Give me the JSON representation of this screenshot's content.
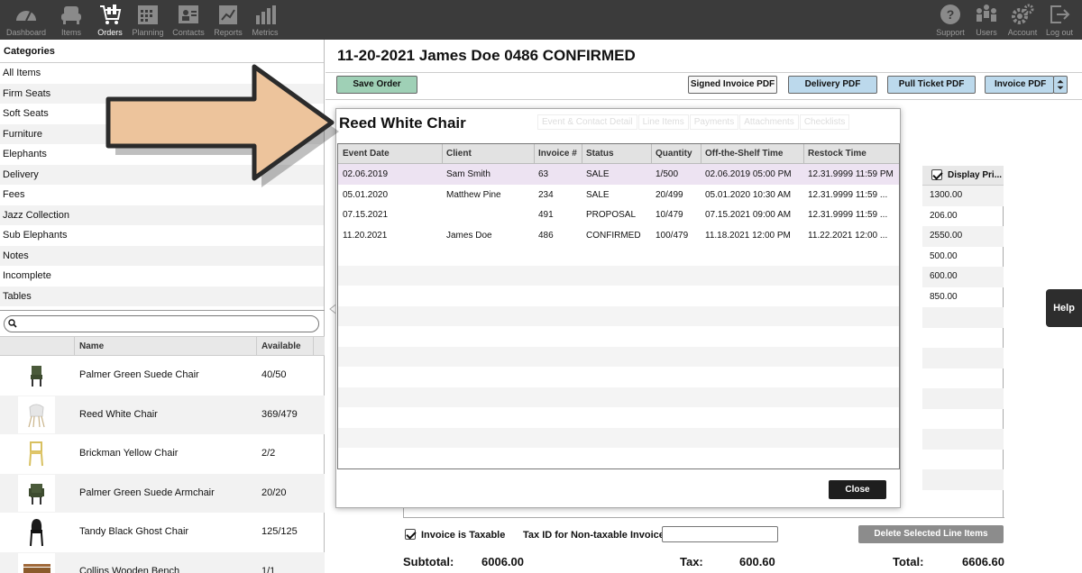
{
  "nav": {
    "left": [
      {
        "label": "Dashboard",
        "icon": "dashboard-icon"
      },
      {
        "label": "Items",
        "icon": "sofa-icon"
      },
      {
        "label": "Orders",
        "icon": "cart-icon",
        "active": true
      },
      {
        "label": "Planning",
        "icon": "calendar-icon"
      },
      {
        "label": "Contacts",
        "icon": "contacts-icon"
      },
      {
        "label": "Reports",
        "icon": "reports-icon"
      },
      {
        "label": "Metrics",
        "icon": "bar-chart-icon"
      }
    ],
    "right": [
      {
        "label": "Support",
        "icon": "help-icon"
      },
      {
        "label": "Users",
        "icon": "users-icon"
      },
      {
        "label": "Account",
        "icon": "gear-icon"
      },
      {
        "label": "Log out",
        "icon": "logout-icon"
      }
    ]
  },
  "categories": {
    "header": "Categories",
    "items": [
      "All Items",
      "Firm Seats",
      "Soft Seats",
      "Furniture",
      "Elephants",
      "Delivery",
      "Fees",
      "Jazz Collection",
      "Sub Elephants",
      "Notes",
      "Incomplete",
      "Tables"
    ]
  },
  "search": {
    "placeholder": ""
  },
  "items_table": {
    "headers": {
      "name": "Name",
      "available": "Available"
    },
    "rows": [
      {
        "name": "Palmer Green Suede Chair",
        "available": "40/50"
      },
      {
        "name": "Reed White Chair",
        "available": "369/479"
      },
      {
        "name": "Brickman Yellow Chair",
        "available": "2/2"
      },
      {
        "name": "Palmer Green Suede Armchair",
        "available": "20/20"
      },
      {
        "name": "Tandy Black Ghost Chair",
        "available": "125/125"
      },
      {
        "name": "Collins Wooden Bench",
        "available": "1/1"
      }
    ]
  },
  "order": {
    "title": "11-20-2021 James Doe 0486 CONFIRMED",
    "buttons": {
      "save": "Save Order",
      "signed_invoice": "Signed Invoice PDF",
      "delivery": "Delivery PDF",
      "pull_ticket": "Pull Ticket PDF",
      "invoice": "Invoice PDF"
    },
    "display_price_header": "Display Pri...",
    "display_prices": [
      "1300.00",
      "206.00",
      "2550.00",
      "500.00",
      "600.00",
      "850.00"
    ],
    "taxable_label": "Invoice is Taxable",
    "tax_id_label": "Tax ID for Non-taxable Invoice:",
    "tax_id_value": "",
    "delete_button": "Delete Selected Line Items",
    "subtotal_label": "Subtotal:",
    "subtotal_value": "6006.00",
    "tax_label": "Tax:",
    "tax_value": "600.60",
    "total_label": "Total:",
    "total_value": "6606.60",
    "help": "Help"
  },
  "modal": {
    "title": "Reed White Chair",
    "ghost_tabs": [
      "Event & Contact Detail",
      "Line Items",
      "Payments",
      "Attachments",
      "Checklists"
    ],
    "headers": [
      "Event Date",
      "Client",
      "Invoice #",
      "Status",
      "Quantity",
      "Off-the-Shelf Time",
      "Restock Time"
    ],
    "rows": [
      {
        "event_date": "02.06.2019",
        "client": "Sam Smith",
        "invoice": "63",
        "status": "SALE",
        "quantity": "1/500",
        "off_shelf": "02.06.2019 05:00 PM",
        "restock": "12.31.9999 11:59 PM"
      },
      {
        "event_date": "05.01.2020",
        "client": "Matthew Pine",
        "invoice": "234",
        "status": "SALE",
        "quantity": "20/499",
        "off_shelf": "05.01.2020 10:30 AM",
        "restock": "12.31.9999 11:59 ..."
      },
      {
        "event_date": "07.15.2021",
        "client": "",
        "invoice": "491",
        "status": "PROPOSAL",
        "quantity": "10/479",
        "off_shelf": "07.15.2021 09:00 AM",
        "restock": "12.31.9999 11:59 ..."
      },
      {
        "event_date": "11.20.2021",
        "client": "James Doe",
        "invoice": "486",
        "status": "CONFIRMED",
        "quantity": "100/479",
        "off_shelf": "11.18.2021 12:00 PM",
        "restock": "11.22.2021 12:00 ..."
      }
    ],
    "close": "Close"
  },
  "colors": {
    "nav_bg": "#3b3b3b",
    "save_green": "#9fd0b6",
    "pdf_blue": "#bcd9ec",
    "selected_row": "#ede3f2",
    "arrow_fill": "#edc49c"
  }
}
